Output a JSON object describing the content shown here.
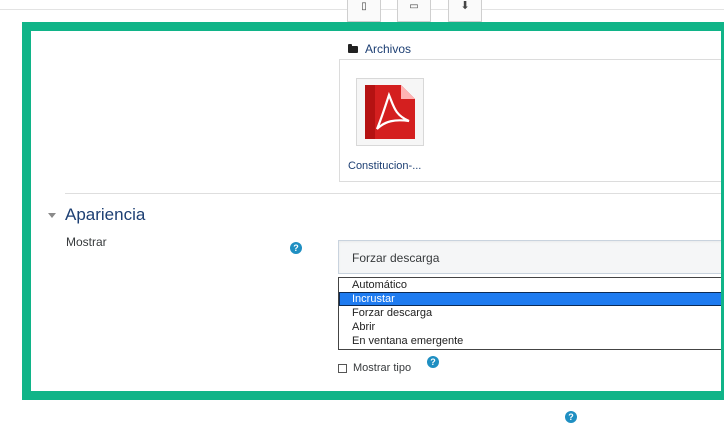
{
  "files": {
    "label": "Archivos",
    "items": [
      {
        "name": "Constitucion-..."
      }
    ]
  },
  "appearance": {
    "section_title": "Apariencia",
    "mostrar": {
      "label": "Mostrar",
      "selected_value": "Forzar descarga",
      "options": [
        "Automático",
        "Incrustar",
        "Forzar descarga",
        "Abrir",
        "En ventana emergente"
      ],
      "highlighted_option": "Incrustar"
    },
    "show_type_label": "Mostrar tipo"
  },
  "help_glyph": "?",
  "colors": {
    "highlight": "#10b488",
    "accent": "#1f8fc2",
    "selected": "#1e7bf0",
    "link": "#1d3f73"
  },
  "icons": [
    "file-icon",
    "folder-icon",
    "download-icon",
    "pdf-icon",
    "help-icon"
  ]
}
